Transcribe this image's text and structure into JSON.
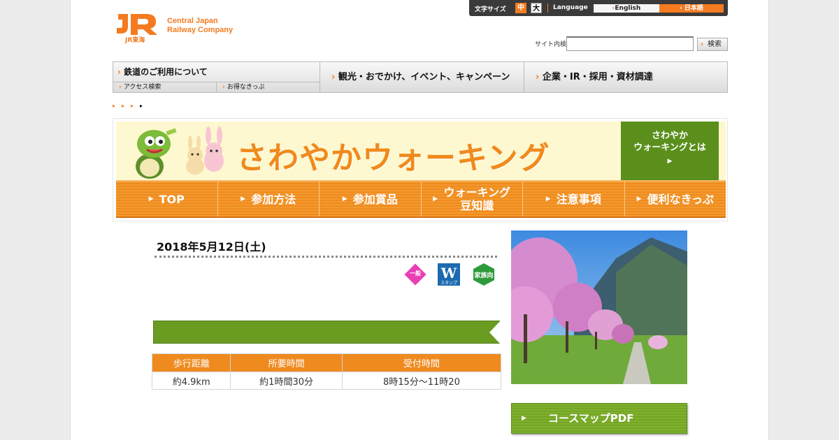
{
  "header": {
    "logo_mark": "JR",
    "logo_sub": "JR東海",
    "company_line1": "Central Japan",
    "company_line2": "Railway Company",
    "text_size_label": "文字サイズ",
    "size_mid": "中",
    "size_big": "大",
    "language_label": "Language",
    "lang_english": "English",
    "lang_japanese": "日本語",
    "search_label": "サイト内検索",
    "search_value": "",
    "search_button": "検索"
  },
  "global_nav": {
    "rail": "鉄道のご利用について",
    "access": "アクセス検索",
    "tickets": "お得なきっぷ",
    "tourism": "観光・おでかけ、イベント、キャンペーン",
    "corporate": "企業・IR・採用・資材調達"
  },
  "banner": {
    "title": "さわやかウォーキング",
    "about_line1": "さわやか",
    "about_line2": "ウォーキングとは",
    "tabs": [
      {
        "label": "TOP"
      },
      {
        "label": "参加方法"
      },
      {
        "label": "参加賞品"
      },
      {
        "label": "ウォーキング 豆知識"
      },
      {
        "label": "注意事項"
      },
      {
        "label": "便利なきっぷ"
      }
    ]
  },
  "event": {
    "date": "2018年5月12日(土)",
    "badges": {
      "general": "一般",
      "w_stamp": "スタンプ",
      "family": "家族向"
    },
    "title": "",
    "course_name": "",
    "table": {
      "headers": [
        "歩行距離",
        "所要時間",
        "受付時間"
      ],
      "values": [
        "約4.9km",
        "約1時間30分",
        "8時15分～11時20"
      ]
    },
    "photo_caption": "",
    "map_button": "コースマップPDF"
  },
  "colors": {
    "brand_orange": "#f47b20",
    "tab_orange": "#ef8a1f",
    "green": "#5a8f1c",
    "banner_cream": "#fdf8cf"
  }
}
